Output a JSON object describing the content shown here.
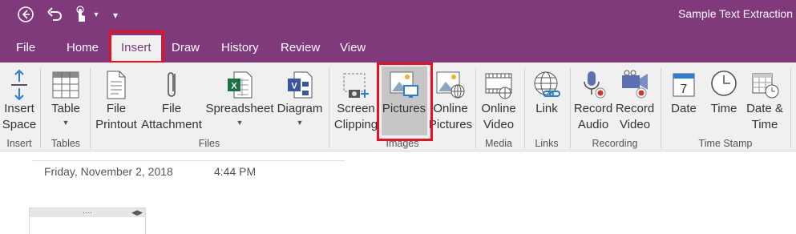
{
  "window": {
    "title": "Sample Text Extraction"
  },
  "quick_access": {
    "back_icon": "back-circle-icon",
    "undo_icon": "undo-icon",
    "touch_icon": "touch-mode-icon",
    "dropdown": "▾"
  },
  "tabs": [
    {
      "label": "File"
    },
    {
      "label": "Home"
    },
    {
      "label": "Insert"
    },
    {
      "label": "Draw"
    },
    {
      "label": "History"
    },
    {
      "label": "Review"
    },
    {
      "label": "View"
    }
  ],
  "ribbon": {
    "buttons": {
      "insert_space": [
        "Insert",
        "Space"
      ],
      "table": [
        "Table"
      ],
      "file_printout": [
        "File",
        "Printout"
      ],
      "file_attachment": [
        "File",
        "Attachment"
      ],
      "spreadsheet": [
        "Spreadsheet"
      ],
      "diagram": [
        "Diagram"
      ],
      "screen_clipping": [
        "Screen",
        "Clipping"
      ],
      "pictures": [
        "Pictures"
      ],
      "online_pictures": [
        "Online",
        "Pictures"
      ],
      "online_video": [
        "Online",
        "Video"
      ],
      "link": [
        "Link"
      ],
      "record_audio": [
        "Record",
        "Audio"
      ],
      "record_video": [
        "Record",
        "Video"
      ],
      "date": [
        "Date"
      ],
      "time": [
        "Time"
      ],
      "date_time": [
        "Date &",
        "Time"
      ]
    },
    "groups": {
      "insert": "Insert",
      "tables": "Tables",
      "files": "Files",
      "images": "Images",
      "media": "Media",
      "links": "Links",
      "recording": "Recording",
      "time_stamp": "Time Stamp"
    },
    "date_icon_number": "7"
  },
  "page": {
    "date": "Friday, November 2, 2018",
    "time": "4:44 PM",
    "container_handle": "····"
  },
  "colors": {
    "accent": "#80397b",
    "highlight": "#e81123"
  }
}
